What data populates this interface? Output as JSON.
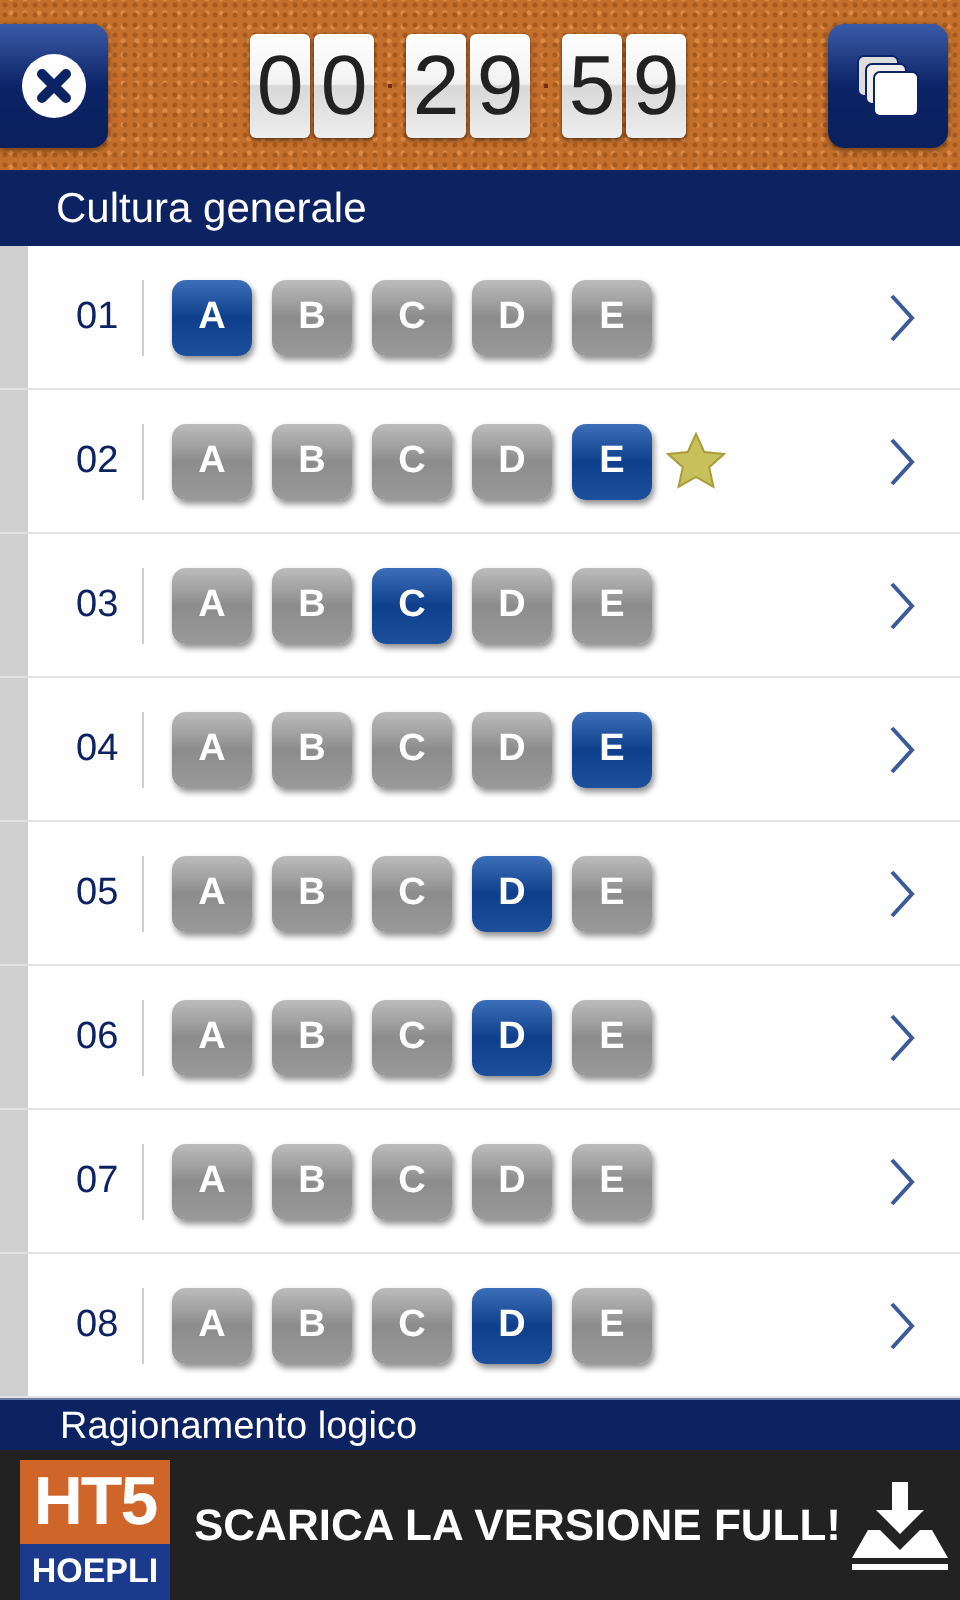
{
  "timer": {
    "hours": "00",
    "minutes": "29",
    "seconds": "59"
  },
  "section": {
    "title": "Cultura generale"
  },
  "questions": [
    {
      "number": "01",
      "starred": false,
      "options": [
        {
          "label": "A",
          "selected": true
        },
        {
          "label": "B",
          "selected": false
        },
        {
          "label": "C",
          "selected": false
        },
        {
          "label": "D",
          "selected": false
        },
        {
          "label": "E",
          "selected": false
        }
      ]
    },
    {
      "number": "02",
      "starred": true,
      "options": [
        {
          "label": "A",
          "selected": false
        },
        {
          "label": "B",
          "selected": false
        },
        {
          "label": "C",
          "selected": false
        },
        {
          "label": "D",
          "selected": false
        },
        {
          "label": "E",
          "selected": true
        }
      ]
    },
    {
      "number": "03",
      "starred": false,
      "options": [
        {
          "label": "A",
          "selected": false
        },
        {
          "label": "B",
          "selected": false
        },
        {
          "label": "C",
          "selected": true
        },
        {
          "label": "D",
          "selected": false
        },
        {
          "label": "E",
          "selected": false
        }
      ]
    },
    {
      "number": "04",
      "starred": false,
      "options": [
        {
          "label": "A",
          "selected": false
        },
        {
          "label": "B",
          "selected": false
        },
        {
          "label": "C",
          "selected": false
        },
        {
          "label": "D",
          "selected": false
        },
        {
          "label": "E",
          "selected": true
        }
      ]
    },
    {
      "number": "05",
      "starred": false,
      "options": [
        {
          "label": "A",
          "selected": false
        },
        {
          "label": "B",
          "selected": false
        },
        {
          "label": "C",
          "selected": false
        },
        {
          "label": "D",
          "selected": true
        },
        {
          "label": "E",
          "selected": false
        }
      ]
    },
    {
      "number": "06",
      "starred": false,
      "options": [
        {
          "label": "A",
          "selected": false
        },
        {
          "label": "B",
          "selected": false
        },
        {
          "label": "C",
          "selected": false
        },
        {
          "label": "D",
          "selected": true
        },
        {
          "label": "E",
          "selected": false
        }
      ]
    },
    {
      "number": "07",
      "starred": false,
      "options": [
        {
          "label": "A",
          "selected": false
        },
        {
          "label": "B",
          "selected": false
        },
        {
          "label": "C",
          "selected": false
        },
        {
          "label": "D",
          "selected": false
        },
        {
          "label": "E",
          "selected": false
        }
      ]
    },
    {
      "number": "08",
      "starred": false,
      "options": [
        {
          "label": "A",
          "selected": false
        },
        {
          "label": "B",
          "selected": false
        },
        {
          "label": "C",
          "selected": false
        },
        {
          "label": "D",
          "selected": true
        },
        {
          "label": "E",
          "selected": false
        }
      ]
    }
  ],
  "next_section": {
    "title": "Ragionamento logico"
  },
  "banner": {
    "logo_top": "HT5",
    "logo_bottom": "HOEPLI",
    "text": "SCARICA LA VERSIONE FULL!"
  }
}
